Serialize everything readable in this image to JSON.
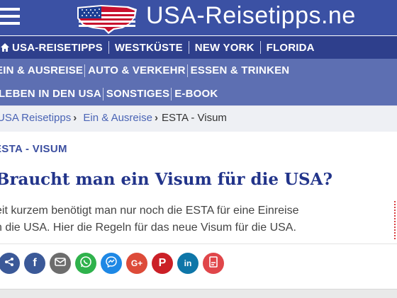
{
  "header": {
    "logo_text": "USA-Reisetipps.ne"
  },
  "nav": {
    "row1": [
      "USA-REISETIPPS",
      "WESTKÜSTE",
      "NEW YORK",
      "FLORIDA"
    ],
    "row2": [
      "EIN & AUSREISE",
      "AUTO & VERKEHR",
      "ESSEN & TRINKEN"
    ],
    "row3": [
      "LEBEN IN DEN USA",
      "SONSTIGES",
      "E-BOOK"
    ]
  },
  "breadcrumb": {
    "home": "USA Reisetipps",
    "section": "Ein & Ausreise",
    "current": "ESTA - Visum",
    "arrow": "›"
  },
  "article": {
    "kicker": "ESTA - VISUM",
    "title": "Braucht man ein Visum für die USA?",
    "lead_line1": "eit kurzem benötigt man nur noch die ESTA für eine Einreise",
    "lead_line2": "n die USA. Hier die Regeln für das neue Visum für die USA."
  },
  "share": {
    "buttons": [
      {
        "icon": "share-icon",
        "label": "",
        "color": "#3b5998"
      },
      {
        "icon": "facebook-icon",
        "label": "f",
        "color": "#3b5998"
      },
      {
        "icon": "email-icon",
        "label": "",
        "color": "#6d6d6d"
      },
      {
        "icon": "whatsapp-icon",
        "label": "",
        "color": "#2fb24c"
      },
      {
        "icon": "messenger-icon",
        "label": "",
        "color": "#1e88e5"
      },
      {
        "icon": "googleplus-icon",
        "label": "G+",
        "color": "#dd4b39"
      },
      {
        "icon": "pinterest-icon",
        "label": "P",
        "color": "#cb2027"
      },
      {
        "icon": "linkedin-icon",
        "label": "in",
        "color": "#0e76a8"
      },
      {
        "icon": "print-icon",
        "label": "",
        "color": "#e0464a"
      }
    ]
  },
  "colors": {
    "header_bg": "#3b51a4",
    "nav_dark": "#2e3f8c",
    "nav_light": "#5d6fb2",
    "title": "#22348a",
    "link": "#4a64b5"
  }
}
